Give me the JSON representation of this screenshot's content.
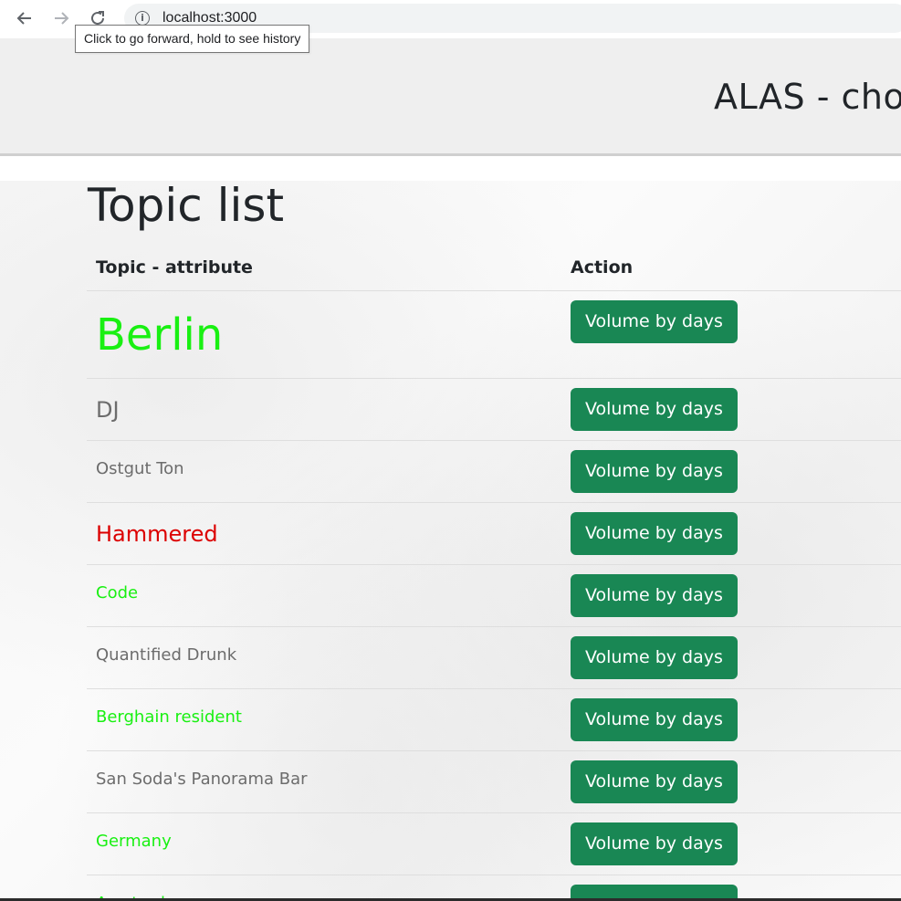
{
  "browser": {
    "url": "localhost:3000",
    "tooltip": "Click to go forward, hold to see history"
  },
  "header": {
    "title": "ALAS - cho"
  },
  "page": {
    "heading": "Topic list"
  },
  "table": {
    "columns": [
      "Topic - attribute",
      "Action"
    ],
    "action_label": "Volume by days",
    "rows": [
      {
        "topic": "Berlin",
        "color": "#19f012",
        "size": "big"
      },
      {
        "topic": "DJ",
        "color": "#6c6c6c",
        "size": "medium"
      },
      {
        "topic": "Ostgut Ton",
        "color": "#6c6c6c",
        "size": "small"
      },
      {
        "topic": "Hammered",
        "color": "#dc0000",
        "size": "medium"
      },
      {
        "topic": "Code",
        "color": "#19f012",
        "size": "small"
      },
      {
        "topic": "Quantified Drunk",
        "color": "#6c6c6c",
        "size": "small"
      },
      {
        "topic": "Berghain resident",
        "color": "#19f012",
        "size": "small"
      },
      {
        "topic": "San Soda's Panorama Bar",
        "color": "#6c6c6c",
        "size": "small"
      },
      {
        "topic": "Germany",
        "color": "#19f012",
        "size": "small"
      },
      {
        "topic": "Amsterdam",
        "color": "#19f012",
        "size": "small"
      }
    ]
  },
  "colors": {
    "button": "#198754",
    "positive": "#19f012",
    "neutral": "#6c6c6c",
    "negative": "#dc0000"
  }
}
